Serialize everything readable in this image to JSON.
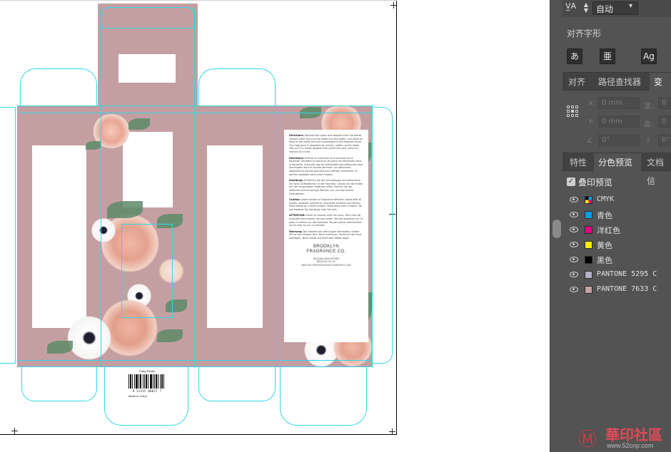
{
  "canvas": {
    "info_panel": {
      "directions_en_title": "Directions:",
      "directions_en": "Remove the collar and stopper from the bottle, replace collar and put the reeds into the bottle, ensuring the ends of the reeds are fully submerged in the fragrant liquid. The fragrance is absorbed by reed(s), soften up the reeds (flip on ?) to subtly disperse the scent into your home for months at a time.",
      "directions_fr_title": "Directions:",
      "directions_fr": "Enlever le manchon et le bouchon de la bouteille, remettre le manchon en place les bâtonnets dans la bouteille. S'assurer que les extrémités des bâtonnets sont immergées dans le liquide parfumé. Les bâtonnets absorbent le liquide parfumé pour diffuser lentement un parfum agréable dans votre maison.",
      "directions_de_title": "Anleitung:",
      "directions_de": "Entfernen Sie die Schutzkappe und Verschluss. Sie dann Duftstäbchen in die Flaschen. Lassen Sie die Enden mit den eingelegten Stäbchen offen. Drehen Sie die Stäbchen einmal wenige Wochen um. Um das Aroma freizusetzen.",
      "caution_title": "Caution:",
      "caution": "Avoid contact of fragrance diffusion liquid with all fragile, oxidised, painted or varnished surfaces and fabrics. Place bottle on a level surface. Keep away from children. Do not swallow. Do not apply onto the skin.",
      "attention_title": "ATTENTION:",
      "attention": "Eviter le contact avec les yeux. Tenir hors de la portée des enfants. Ne pas avaler. Ne pas appliquer sur la peau ni utiliser sur des meubles. Ne pas placer directement sur du bois ou sur un meuble.",
      "warnung_title": "Warnung:",
      "warnung": "Der Kontakt mit den Augen vermeiden. Halten Sie es von Kindern fern. Nicht schlucken. Nicht auf die Haut auftragen. Nicht direkt auf Stoff oder Möbel legen.",
      "brand_line1": "BROOKLYN",
      "brand_line2": "FRAGRANCE CO.",
      "address_line1": "JACKAM INDUSTRIES",
      "address_line2": "BROOKLYN, NY",
      "address_line3": "BROOKLYNFRAGRANCECOMPANY.COM"
    },
    "barcode": {
      "product_label": "Party Petals",
      "number": "8 52315 00027 7",
      "made_in": "Made in China"
    }
  },
  "panel": {
    "tracking": {
      "icon": "tracking-icon",
      "value": "自动"
    },
    "align_type": {
      "title": "对齐字形",
      "buttons": [
        "あ",
        "亜",
        "Ag"
      ]
    },
    "tabs_top": [
      "对齐",
      "路径查找器",
      "变"
    ],
    "transform": {
      "x_label": "X:",
      "x_value": "0 mm",
      "y_label": "Y:",
      "y_value": "0 mm",
      "w_label": "宽:",
      "w_value": "0",
      "h_label": "高:",
      "h_value": "0",
      "angle_value": "0°",
      "shear_value": "0°"
    },
    "tabs_bottom": [
      "特性",
      "分色预览",
      "文档信"
    ],
    "separations": {
      "overprint_label": "叠印预览",
      "overprint_checked": true,
      "plates": [
        {
          "name": "CMYK",
          "color": "cmyk"
        },
        {
          "name": "青色",
          "color": "#00a0e9"
        },
        {
          "name": "洋红色",
          "color": "#e4007f"
        },
        {
          "name": "黄色",
          "color": "#fff100"
        },
        {
          "name": "黑色",
          "color": "#000000"
        },
        {
          "name": "PANTONE 5295 C",
          "color": "#b4b1c9"
        },
        {
          "name": "PANTONE 7633 C",
          "color": "#c4a0a2"
        }
      ]
    }
  },
  "watermark": {
    "text": "華印社區",
    "url": "www.52cnp.com"
  }
}
